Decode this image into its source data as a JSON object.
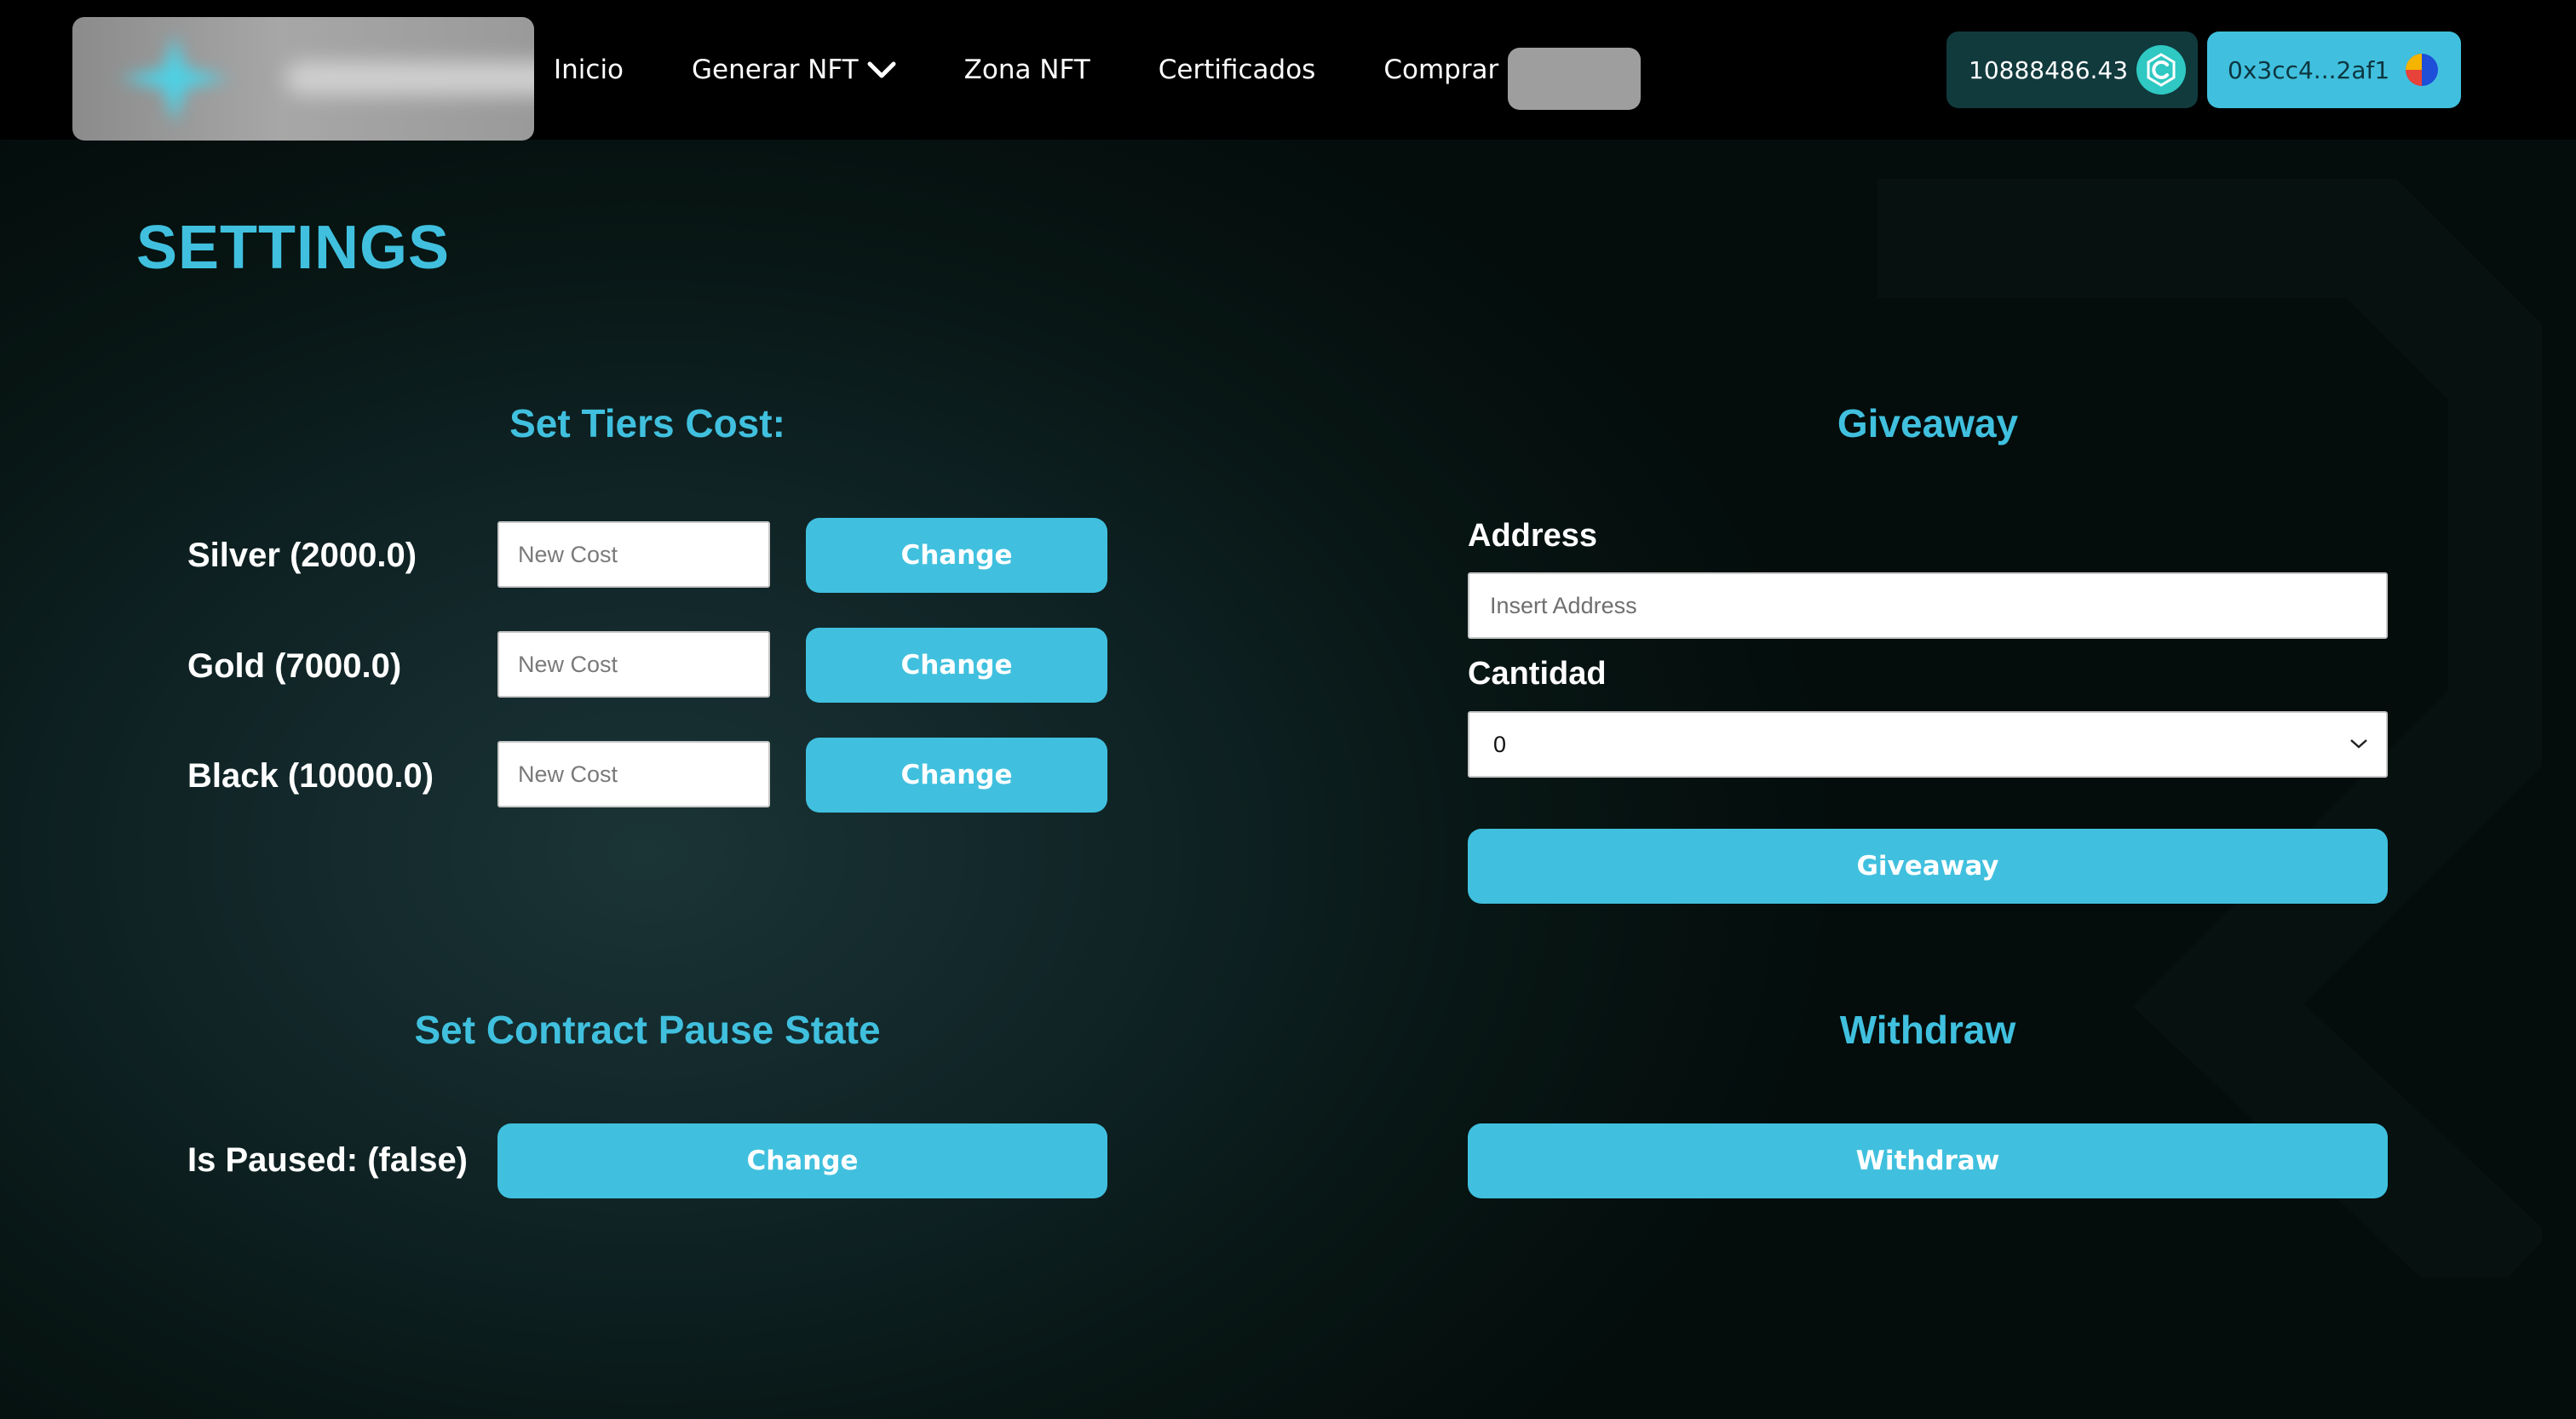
{
  "nav": {
    "links": [
      "Inicio",
      "Generar NFT",
      "Zona NFT",
      "Certificados",
      "Comprar $"
    ],
    "balance": "10888486.43",
    "wallet_address": "0x3cc4...2af1"
  },
  "page": {
    "title": "SETTINGS"
  },
  "tiers": {
    "title": "Set Tiers Cost:",
    "rows": [
      {
        "label": "Silver (2000.0)",
        "placeholder": "New Cost",
        "button": "Change"
      },
      {
        "label": "Gold (7000.0)",
        "placeholder": "New Cost",
        "button": "Change"
      },
      {
        "label": "Black (10000.0)",
        "placeholder": "New Cost",
        "button": "Change"
      }
    ]
  },
  "giveaway": {
    "title": "Giveaway",
    "address_label": "Address",
    "address_placeholder": "Insert Address",
    "amount_label": "Cantidad",
    "amount_value": "0",
    "button": "Giveaway"
  },
  "pause": {
    "title": "Set Contract Pause State",
    "label": "Is Paused: (false)",
    "button": "Change"
  },
  "withdraw": {
    "title": "Withdraw",
    "button": "Withdraw"
  },
  "colors": {
    "accent": "#40c0de",
    "nav_bg": "#000000",
    "balance_bg": "#113a3d",
    "page_bg": "#0a1a1a"
  },
  "icons": {
    "token": "token-c-icon",
    "wallet": "wallet-avatar-icon",
    "dropdown": "chevron-down-icon"
  }
}
